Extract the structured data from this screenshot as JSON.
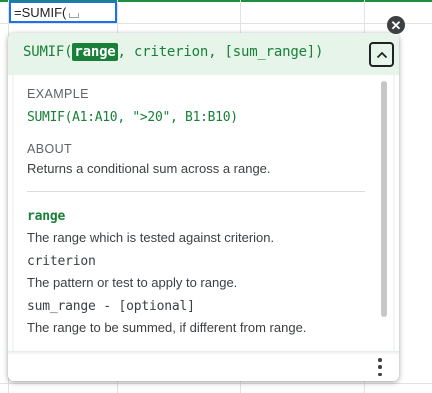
{
  "cell": {
    "formula_text": "=SUMIF("
  },
  "function_help": {
    "signature": {
      "function_name": "SUMIF",
      "open_paren": "(",
      "active_argument": "range",
      "rest": ", criterion, [sum_range])"
    },
    "example": {
      "title": "EXAMPLE",
      "code": "SUMIF(A1:A10, \">20\", B1:B10)"
    },
    "about": {
      "title": "ABOUT",
      "text": "Returns a conditional sum across a range."
    },
    "arguments": [
      {
        "name": "range",
        "description": "The range which is tested against criterion.",
        "active": true
      },
      {
        "name": "criterion",
        "description": "The pattern or test to apply to range.",
        "active": false
      },
      {
        "name": "sum_range - [optional]",
        "description": "The range to be summed, if different from range.",
        "active": false
      }
    ],
    "icons": {
      "close": "close-circle-icon",
      "collapse": "chevron-up-icon",
      "more": "more-vert-icon"
    }
  },
  "colors": {
    "accent_green": "#188038",
    "header_background": "#e6f4ea",
    "cell_border_blue": "#1a73e8",
    "body_text": "#3c4043",
    "muted_text": "#5f6368"
  }
}
